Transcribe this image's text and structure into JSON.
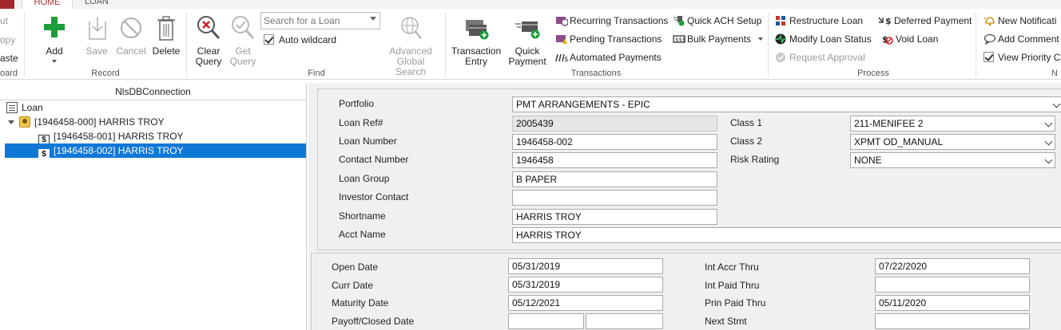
{
  "ribbon": {
    "tabs": [
      "HOME",
      "LOAN"
    ],
    "clipboard": {
      "cut": "ut",
      "copy": "opy",
      "paste": "aste",
      "group": "oard"
    },
    "record": {
      "add": "Add",
      "save": "Save",
      "cancel": "Cancel",
      "delete": "Delete",
      "group": "Record"
    },
    "find": {
      "clear_query": [
        "Clear",
        "Query"
      ],
      "get_query": [
        "Get",
        "Query"
      ],
      "search_placeholder": "Search for a Loan",
      "auto_wildcard": "Auto wildcard",
      "advanced": [
        "Advanced",
        "Global Search"
      ],
      "group": "Find"
    },
    "transactions": {
      "transaction_entry": [
        "Transaction",
        "Entry"
      ],
      "quick_payment": [
        "Quick",
        "Payment"
      ],
      "recurring": "Recurring Transactions",
      "pending": "Pending Transactions",
      "automated": "Automated Payments",
      "quick_ach": "Quick ACH Setup",
      "bulk": "Bulk Payments",
      "group": "Transactions"
    },
    "process": {
      "restructure": "Restructure Loan",
      "deferred": "Deferred Payment",
      "modify_status": "Modify Loan Status",
      "void": "Void Loan",
      "request_approval": "Request Approval",
      "group": "Process"
    },
    "notifications": {
      "new_notification": "New Notificati",
      "add_comment": "Add Comment",
      "view_priority": "View Priority C",
      "group": "N"
    }
  },
  "tree": {
    "header": "NlsDBConnection",
    "root": "Loan",
    "contact": "[1946458-000] HARRIS TROY",
    "loans": [
      "[1946458-001] HARRIS TROY",
      "[1946458-002] HARRIS TROY"
    ]
  },
  "form": {
    "portfolio": {
      "label": "Portfolio",
      "value": "PMT ARRANGEMENTS - EPIC"
    },
    "loan_ref": {
      "label": "Loan Ref#",
      "value": "2005439"
    },
    "loan_number": {
      "label": "Loan Number",
      "value": "1946458-002"
    },
    "contact_number": {
      "label": "Contact Number",
      "value": "1946458"
    },
    "loan_group": {
      "label": "Loan Group",
      "value": "B PAPER"
    },
    "investor_contact": {
      "label": "Investor Contact",
      "value": ""
    },
    "shortname": {
      "label": "Shortname",
      "value": "HARRIS TROY"
    },
    "acct_name": {
      "label": "Acct Name",
      "value": "HARRIS TROY"
    },
    "class1": {
      "label": "Class 1",
      "value": "211-MENIFEE 2"
    },
    "class2": {
      "label": "Class 2",
      "value": "XPMT OD_MANUAL"
    },
    "risk_rating": {
      "label": "Risk Rating",
      "value": "NONE"
    }
  },
  "dates": {
    "open_date": {
      "label": "Open Date",
      "value": "05/31/2019"
    },
    "curr_date": {
      "label": "Curr Date",
      "value": "05/31/2019"
    },
    "maturity_date": {
      "label": "Maturity Date",
      "value": "05/12/2021"
    },
    "payoff_closed_date": {
      "label": "Payoff/Closed Date",
      "value": "",
      "value2": ""
    },
    "int_accr_thru": {
      "label": "Int Accr Thru",
      "value": "07/22/2020"
    },
    "int_paid_thru": {
      "label": "Int Paid Thru",
      "value": ""
    },
    "prin_paid_thru": {
      "label": "Prin Paid Thru",
      "value": "05/11/2020"
    },
    "next_stmt": {
      "label": "Next Stmt",
      "value": ""
    }
  }
}
